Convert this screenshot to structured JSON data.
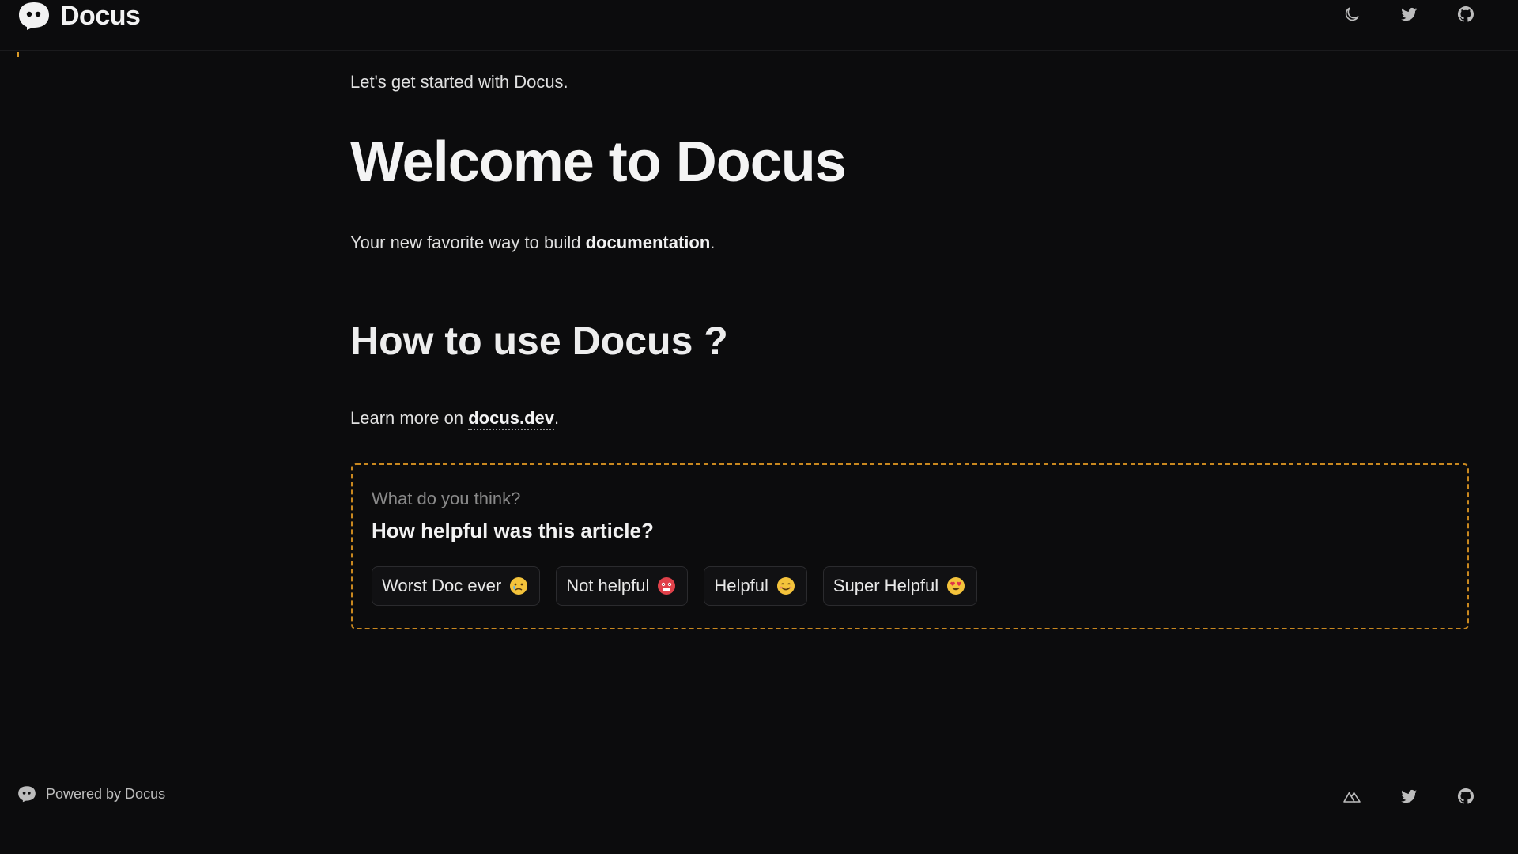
{
  "header": {
    "brand": "Docus",
    "icons": [
      "moon-icon",
      "twitter-icon",
      "github-icon"
    ]
  },
  "content": {
    "intro": "Let's get started with Docus.",
    "title": "Welcome to Docus",
    "subtitle_prefix": "Your new favorite way to build ",
    "subtitle_strong": "documentation",
    "subtitle_suffix": ".",
    "section_heading": "How to use Docus ?",
    "learn_prefix": "Learn more on ",
    "learn_link": "docus.dev",
    "learn_suffix": "."
  },
  "feedback": {
    "question": "What do you think?",
    "title": "How helpful was this article?",
    "options": [
      {
        "label": "Worst Doc ever",
        "emoji": "crying-face-icon"
      },
      {
        "label": "Not helpful",
        "emoji": "angry-face-icon"
      },
      {
        "label": "Helpful",
        "emoji": "smiling-face-icon"
      },
      {
        "label": "Super Helpful",
        "emoji": "heart-eyes-face-icon"
      }
    ]
  },
  "footer": {
    "powered_by": "Powered by Docus",
    "icons": [
      "nuxt-icon",
      "twitter-icon",
      "github-icon"
    ]
  },
  "colors": {
    "background": "#0c0c0d",
    "accent": "#c9881f",
    "text": "#e6e6e6",
    "muted": "#8a8a8a"
  }
}
